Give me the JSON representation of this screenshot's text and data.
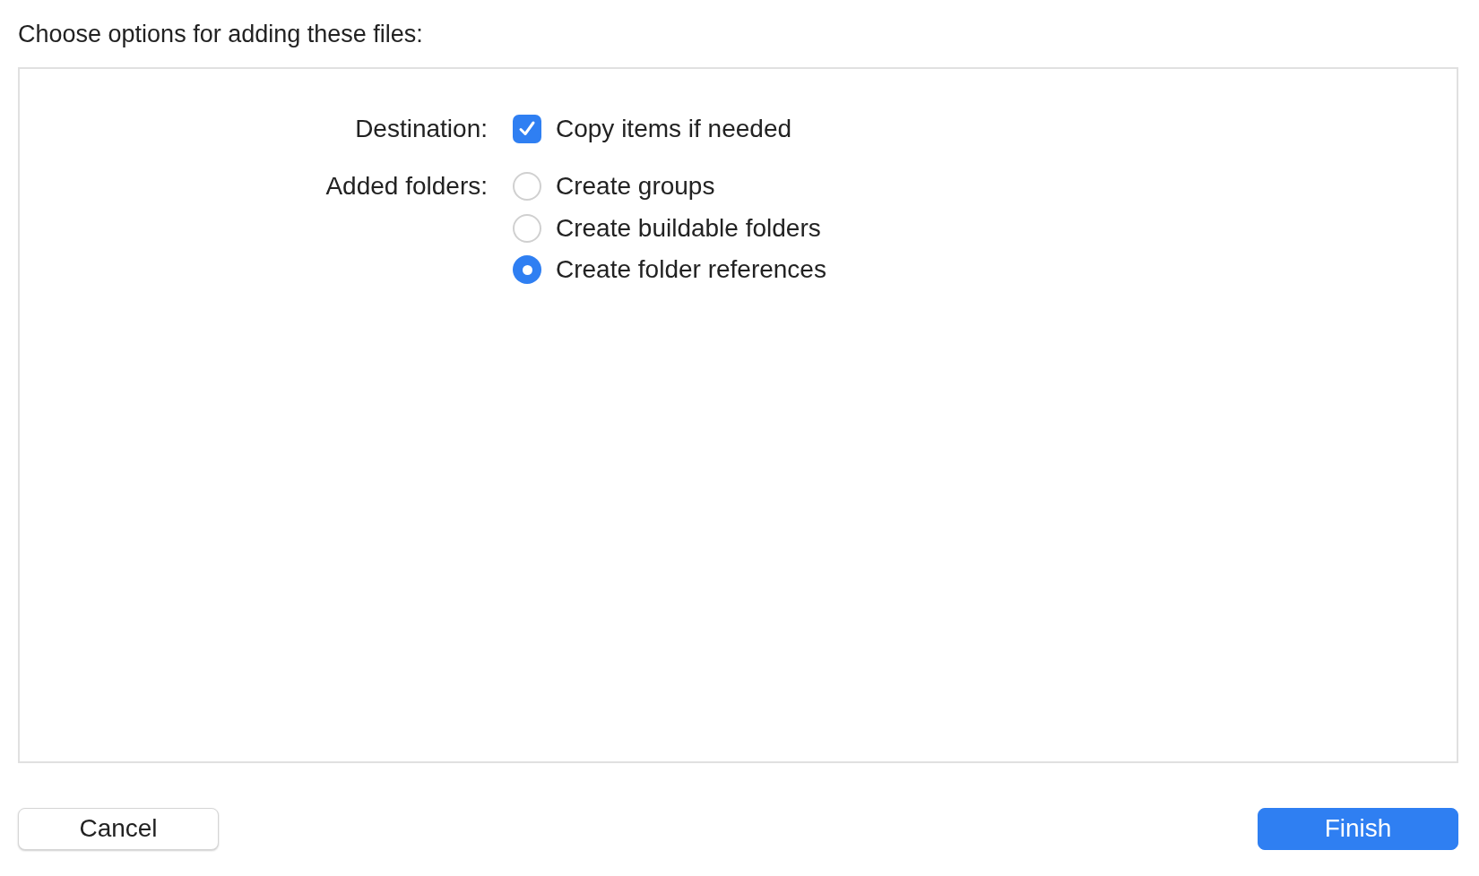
{
  "title": "Choose options for adding these files:",
  "destination": {
    "label": "Destination:",
    "option": {
      "label": "Copy items if needed",
      "checked": true
    }
  },
  "added_folders": {
    "label": "Added folders:",
    "options": [
      {
        "label": "Create groups",
        "selected": false
      },
      {
        "label": "Create buildable folders",
        "selected": false
      },
      {
        "label": "Create folder references",
        "selected": true
      }
    ]
  },
  "buttons": [
    {
      "label": "Cancel",
      "kind": "secondary"
    },
    {
      "label": "Finish",
      "kind": "primary"
    }
  ]
}
